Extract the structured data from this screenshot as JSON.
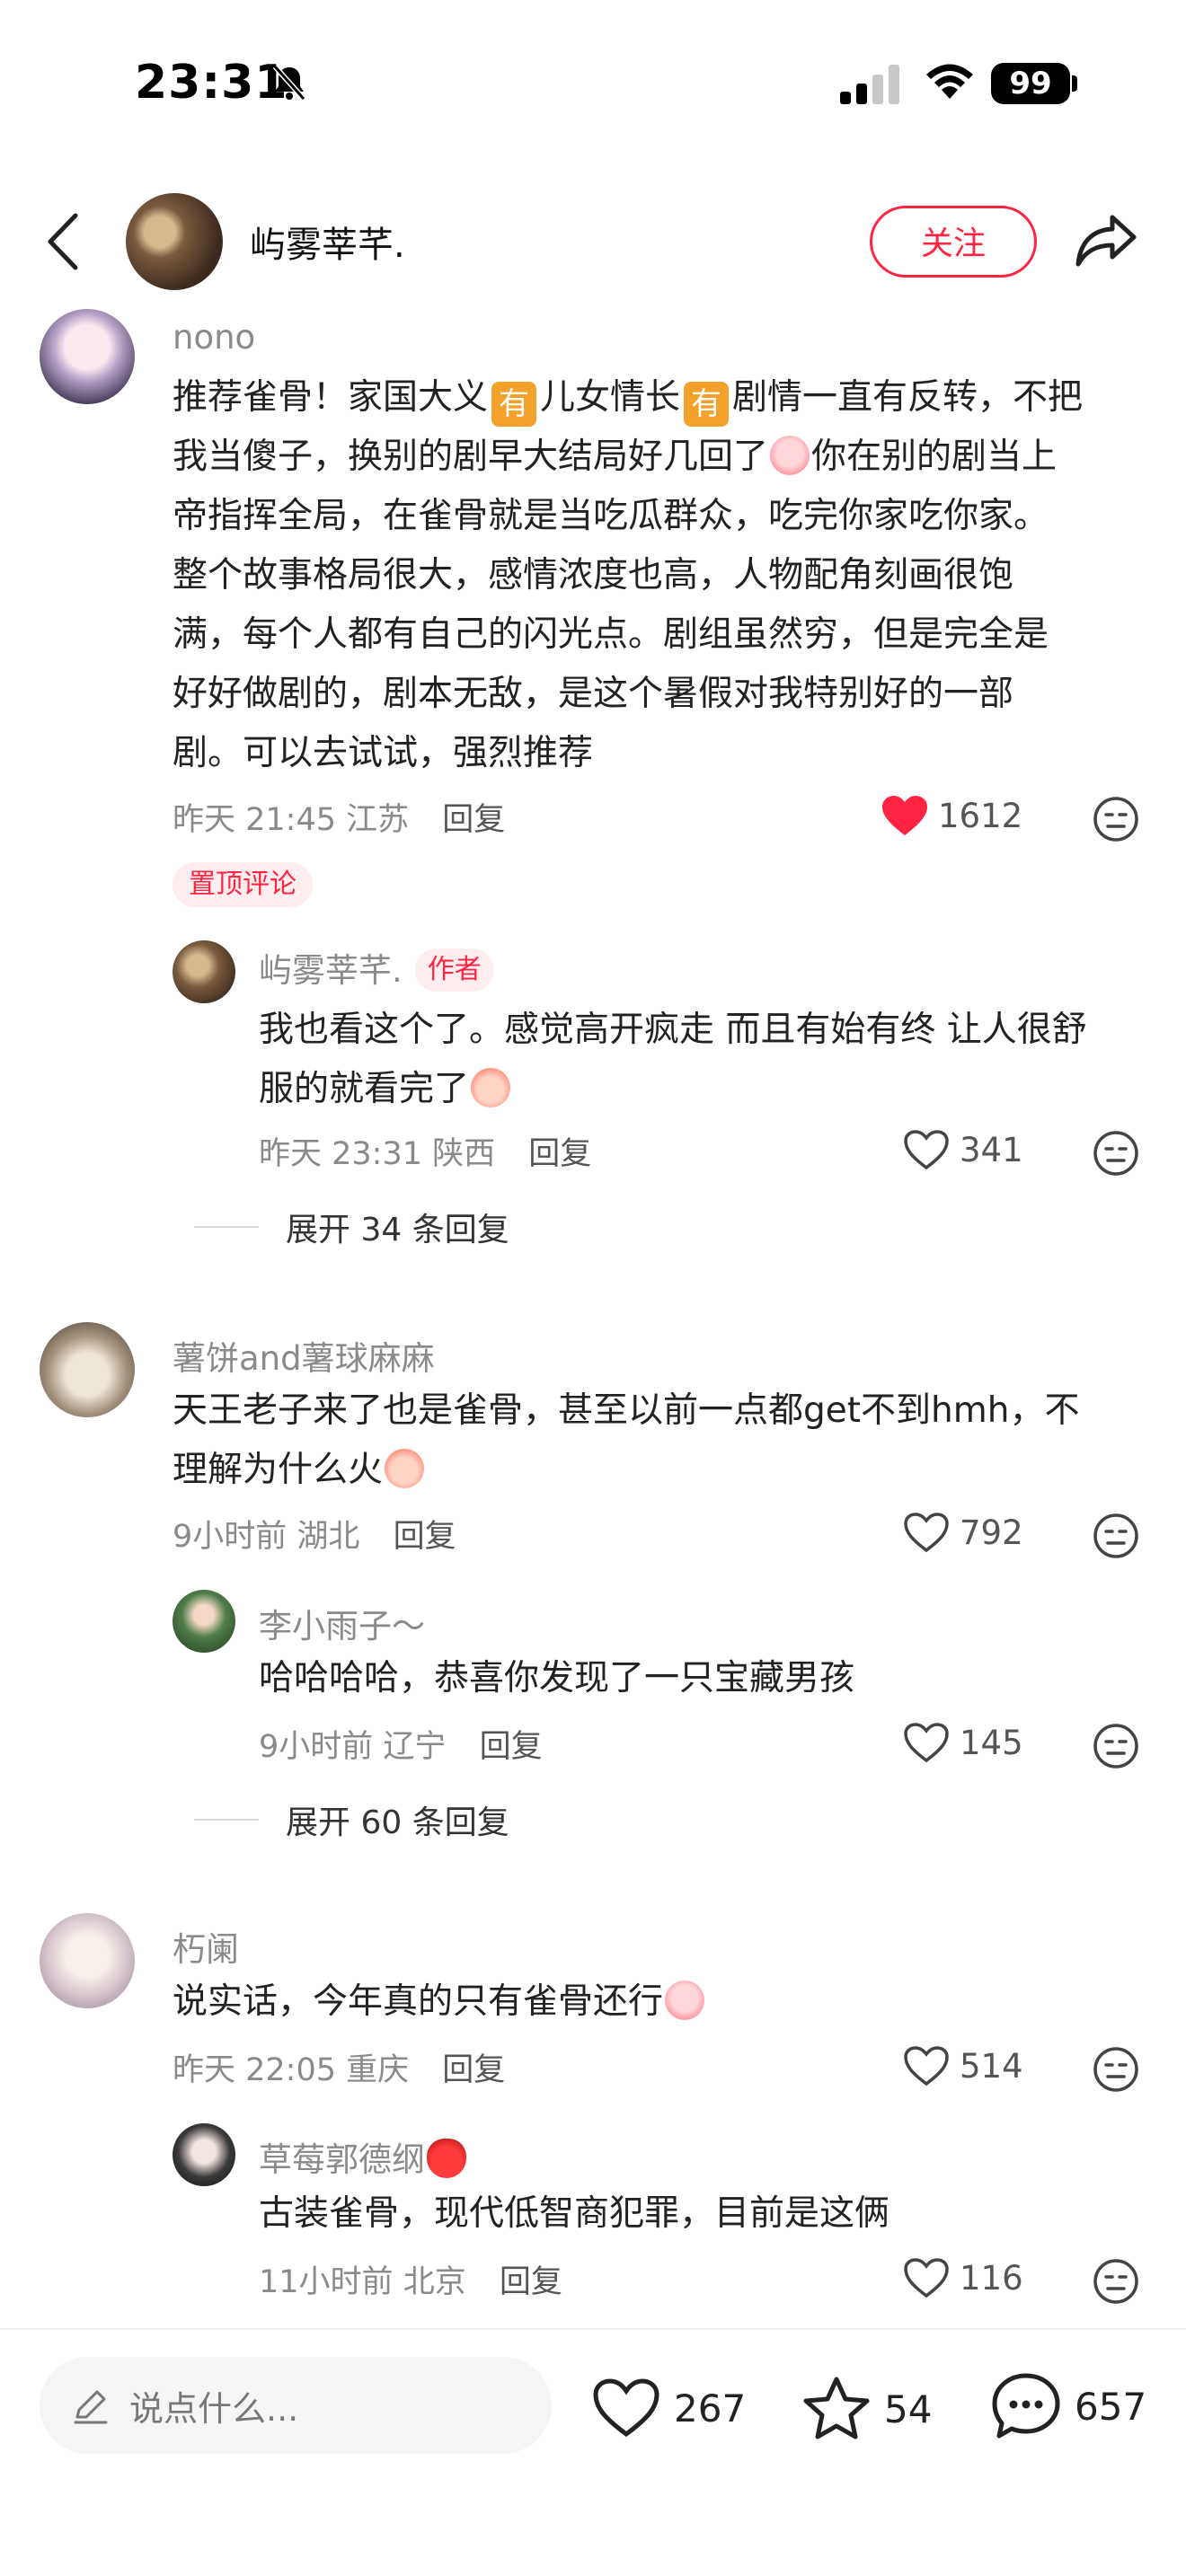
{
  "status_bar": {
    "time": "23:31",
    "battery": "99"
  },
  "header": {
    "username": "屿雾莘芊.",
    "follow_label": "关注"
  },
  "pinned_comment": {
    "username": "nono",
    "text_lines": [
      "推荐雀骨！家国大义",
      "儿女情长",
      "剧情一直有反转，不把",
      "我当傻子，换别的剧早大结局好几回了",
      "你在别的剧当上",
      "帝指挥全局，在雀骨就是当吃瓜群众，吃完你家吃你家。",
      "整个故事格局很大，感情浓度也高，人物配角刻画很饱",
      "满，每个人都有自己的闪光点。剧组虽然穷，但是完全是",
      "好好做剧的，剧本无敌，是这个暑假对我特别好的一部",
      "剧。可以去试试，强烈推荐"
    ],
    "you_badge": "有",
    "time": "昨天 21:45",
    "location": "江苏",
    "reply_label": "回复",
    "likes": "1612",
    "pin_label": "置顶评论",
    "reply": {
      "username": "屿雾莘芊.",
      "author_badge": "作者",
      "text_line1": "我也看这个了。感觉高开疯走 而且有始有终 让人很舒",
      "text_line2": "服的就看完了",
      "time": "昨天 23:31",
      "location": "陕西",
      "reply_label": "回复",
      "likes": "341"
    },
    "expand_label": "展开 34 条回复"
  },
  "comment2": {
    "username": "薯饼and薯球麻麻",
    "text_line1": "天王老子来了也是雀骨，甚至以前一点都get不到hmh，不",
    "text_line2": "理解为什么火",
    "time": "9小时前",
    "location": "湖北",
    "reply_label": "回复",
    "likes": "792",
    "reply": {
      "username": "李小雨子～",
      "text": "哈哈哈哈，恭喜你发现了一只宝藏男孩",
      "time": "9小时前",
      "location": "辽宁",
      "reply_label": "回复",
      "likes": "145"
    },
    "expand_label": "展开 60 条回复"
  },
  "comment3": {
    "username": "朽阑",
    "text": "说实话，今年真的只有雀骨还行",
    "time": "昨天 22:05",
    "location": "重庆",
    "reply_label": "回复",
    "likes": "514",
    "reply": {
      "username": "草莓郭德纲",
      "text": "古装雀骨，现代低智商犯罪，目前是这俩",
      "time": "11小时前",
      "location": "北京",
      "reply_label": "回复",
      "likes": "116"
    }
  },
  "bottom_bar": {
    "input_placeholder": "说点什么...",
    "likes": "267",
    "stars": "54",
    "comments": "657"
  },
  "colors": {
    "accent": "#ff2442",
    "liked": "#ff2442",
    "badge_bg": "#ffeef0"
  }
}
